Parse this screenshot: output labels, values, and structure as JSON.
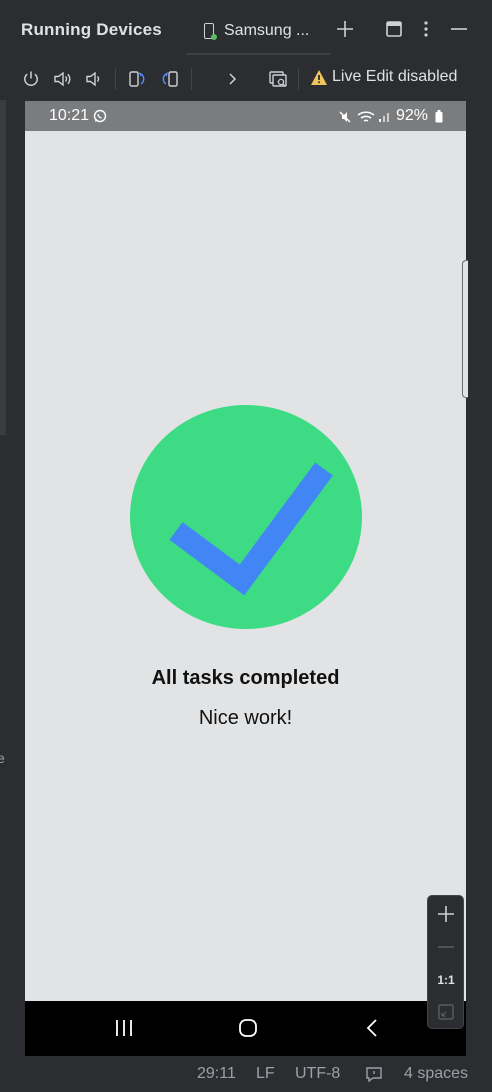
{
  "titlebar": {
    "title": "Running Devices",
    "tab_label": "Samsung ...",
    "add_icon": "plus-icon",
    "window_icon": "window-layout-icon",
    "more_icon": "more-vertical-icon",
    "minimize_icon": "minimize-icon"
  },
  "toolbar": {
    "live_edit_label": "Live Edit disabled",
    "warning_color": "#f2c55c",
    "accent_color": "#548af7"
  },
  "left_edge": {
    "text": "e"
  },
  "device": {
    "time": "10:21",
    "battery": "92%",
    "headline": "All tasks completed",
    "subline": "Nice work!",
    "circle_color": "#3ddc84",
    "check_color": "#4285f4"
  },
  "zoom": {
    "one_to_one": "1:1"
  },
  "status": {
    "position": "29:11",
    "line_ending": "LF",
    "encoding": "UTF-8",
    "indent": "4 spaces"
  }
}
